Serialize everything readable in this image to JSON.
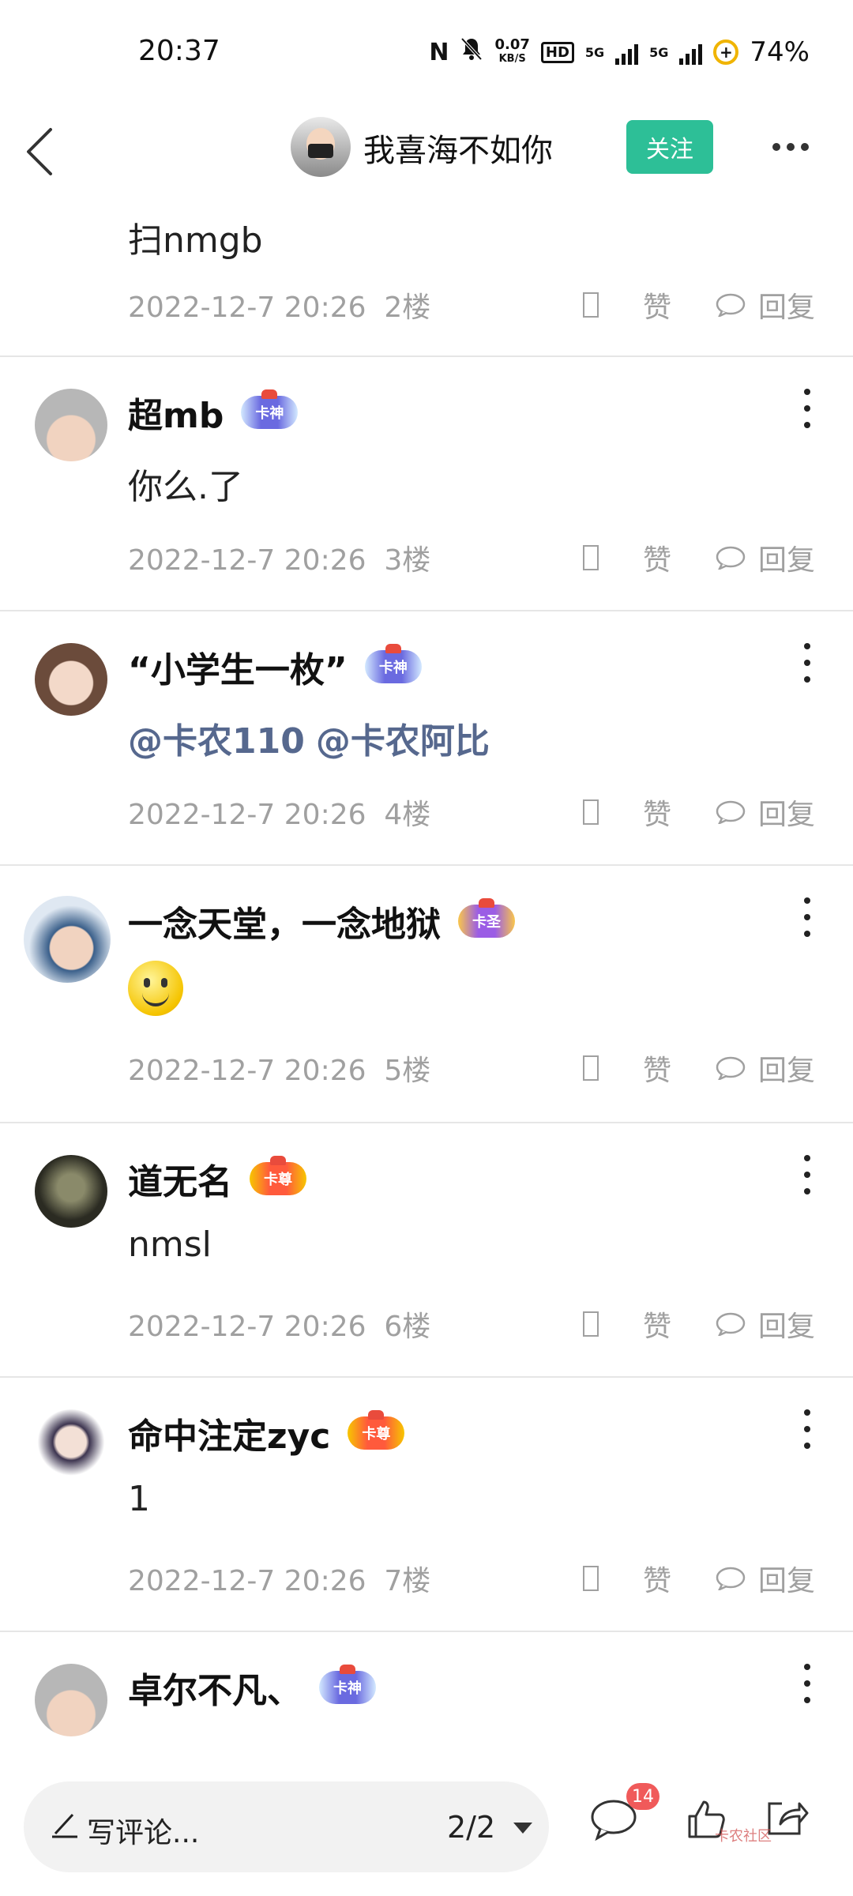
{
  "status_bar": {
    "time": "20:37",
    "nfc_icon": "N",
    "speed_value": "0.07",
    "speed_unit": "KB/S",
    "hd_label": "HD",
    "net_label_1": "5G",
    "net_label_2": "5G",
    "battery": "74%"
  },
  "header": {
    "author_name": "我喜海不如你",
    "follow_label": "关注"
  },
  "first_comment": {
    "text": "扫nmgb",
    "time": "2022-12-7 20:26",
    "floor": "2楼"
  },
  "comments": [
    {
      "user": "超mb",
      "badge": "卡神",
      "text": "你么.了",
      "time": "2022-12-7 20:26",
      "floor": "3楼"
    },
    {
      "user": "“小学生一枚”",
      "badge": "卡神",
      "mention1": "@卡农110",
      "mention2": "@卡农阿比",
      "time": "2022-12-7 20:26",
      "floor": "4楼"
    },
    {
      "user": "一念天堂，一念地狱",
      "badge": "卡圣",
      "time": "2022-12-7 20:26",
      "floor": "5楼"
    },
    {
      "user": "道无名",
      "badge": "卡尊",
      "text": "nmsl",
      "time": "2022-12-7 20:26",
      "floor": "6楼"
    },
    {
      "user": "命中注定zyc",
      "badge": "卡尊",
      "text": "1",
      "time": "2022-12-7 20:26",
      "floor": "7楼"
    },
    {
      "user": "卓尔不凡、",
      "badge": "卡神"
    }
  ],
  "actions": {
    "like_label": "赞",
    "reply_label": "回复"
  },
  "bottom": {
    "input_placeholder": "写评论...",
    "page_indicator": "2/2",
    "comment_count": "14",
    "watermark": "卡农社区"
  },
  "colors": {
    "accent": "#2dbf97",
    "mention": "#56688e",
    "meta": "#a0a0a0",
    "badge_red": "#f05a5a"
  }
}
